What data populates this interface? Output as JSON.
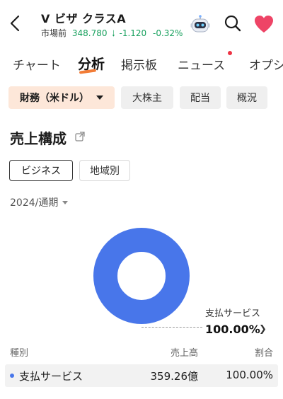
{
  "header": {
    "symbol_title": "V  ビザ クラスA",
    "market_label": "市場前",
    "price": "348.780",
    "change": "-1.120",
    "change_pct": "-0.32%"
  },
  "tabs": [
    {
      "label": "チャート"
    },
    {
      "label": "分析"
    },
    {
      "label": "掲示板"
    },
    {
      "label": "ニュース"
    },
    {
      "label": "オプシ"
    }
  ],
  "filter_chips": [
    {
      "label": "財務（米ドル）"
    },
    {
      "label": "大株主"
    },
    {
      "label": "配当"
    },
    {
      "label": "概況"
    }
  ],
  "section": {
    "title": "売上構成"
  },
  "segments": [
    {
      "label": "ビジネス"
    },
    {
      "label": "地域別"
    }
  ],
  "period": {
    "label": "2024/通期"
  },
  "chart_data": {
    "type": "pie",
    "categories": [
      "支払サービス"
    ],
    "values": [
      100.0
    ],
    "colors": [
      "#4876ea"
    ],
    "callout": {
      "label": "支払サービス",
      "value": "100.00%"
    }
  },
  "table": {
    "headers": {
      "type": "種別",
      "revenue": "売上高",
      "share": "割合"
    },
    "rows": [
      {
        "name": "支払サービス",
        "revenue": "359.26億",
        "share": "100.00%"
      }
    ]
  },
  "colors": {
    "accent": "#f27c36",
    "down": "#17a05d",
    "series": "#4876ea",
    "heart": "#ee4466"
  }
}
